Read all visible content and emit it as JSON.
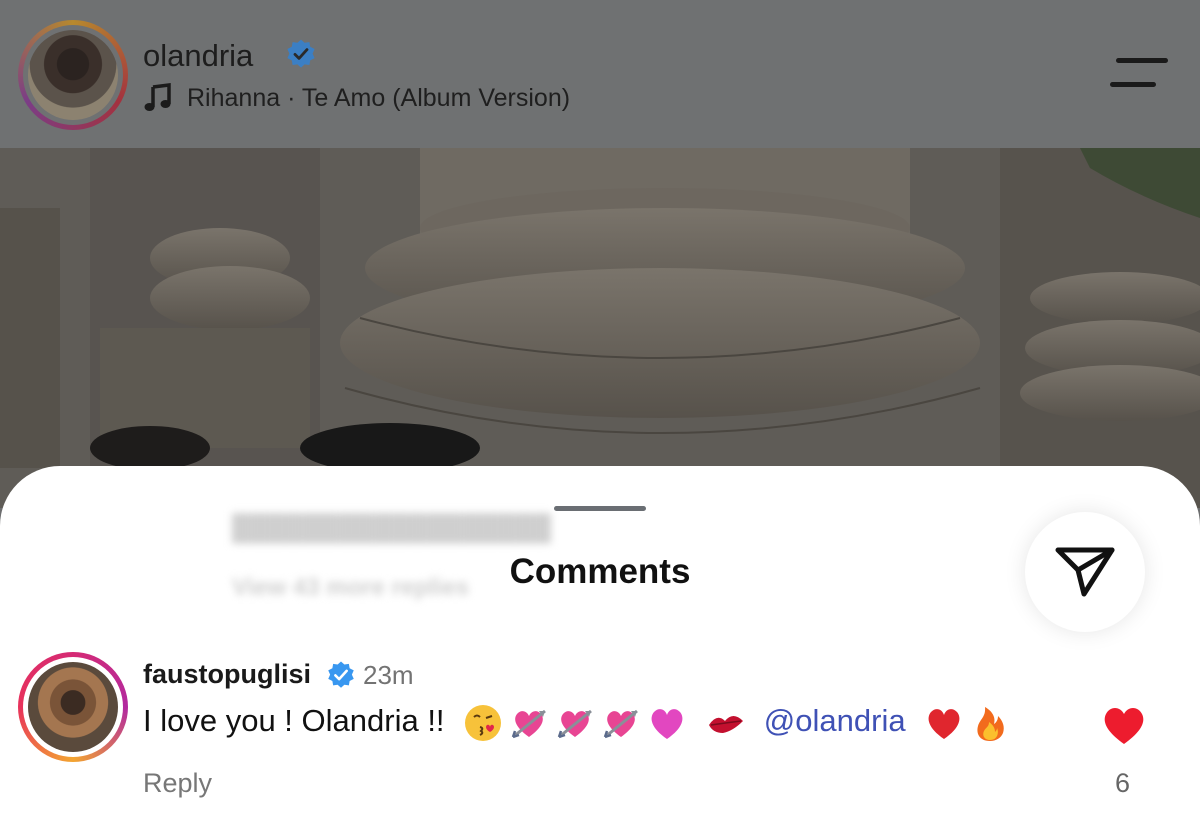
{
  "header": {
    "username": "olandria",
    "song": "Rihanna · Te Amo (Album Version)"
  },
  "sheet": {
    "title": "Comments",
    "ghost_line_1": "View 43 more replies",
    "ghost_line_2": "Reply"
  },
  "comment": {
    "username": "faustopuglisi",
    "time": "23m",
    "text": "I love you ! Olandria !!",
    "mention": "@olandria",
    "emojis": [
      "kissing-face",
      "heart-with-arrow",
      "heart-with-arrow",
      "heart-with-arrow",
      "pink-heart",
      "kiss-mark",
      "red-heart",
      "fire"
    ],
    "reply_label": "Reply",
    "like_count": "6"
  },
  "colors": {
    "verified": "#3897f0",
    "like_heart": "#ed1c2e",
    "mention": "#3f51b5",
    "overlay": "#6f7172"
  },
  "icons": {
    "music": "music-note-icon",
    "menu": "menu-icon",
    "share": "paper-plane-icon",
    "like": "heart-icon"
  }
}
